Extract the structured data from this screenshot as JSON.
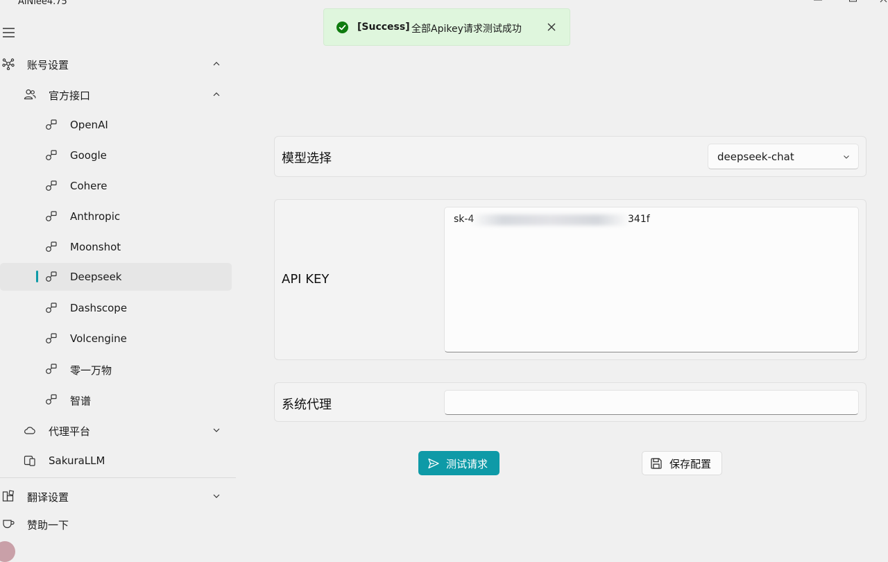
{
  "app": {
    "title": "AiNiee4.75"
  },
  "toast": {
    "title": "[Success]",
    "message": "全部Apikey请求测试成功"
  },
  "sidebar": {
    "account_settings": "账号设置",
    "official_api": "官方接口",
    "providers": [
      "OpenAI",
      "Google",
      "Cohere",
      "Anthropic",
      "Moonshot",
      "Deepseek",
      "Dashscope",
      "Volcengine",
      "零一万物",
      "智谱"
    ],
    "selected_provider": "Deepseek",
    "proxy_platform": "代理平台",
    "sakura": "SakuraLLM",
    "translation_settings": "翻译设置",
    "sponsor": "赞助一下"
  },
  "form": {
    "model_label": "模型选择",
    "model_value": "deepseek-chat",
    "api_key_label": "API KEY",
    "api_key_prefix": "sk-4",
    "api_key_suffix": "341f",
    "proxy_label": "系统代理",
    "proxy_value": ""
  },
  "buttons": {
    "test": "测试请求",
    "save": "保存配置"
  },
  "colors": {
    "accent": "#0e9aa7",
    "success_bg": "#dff6dd",
    "success_icon": "#0f7b0f"
  }
}
